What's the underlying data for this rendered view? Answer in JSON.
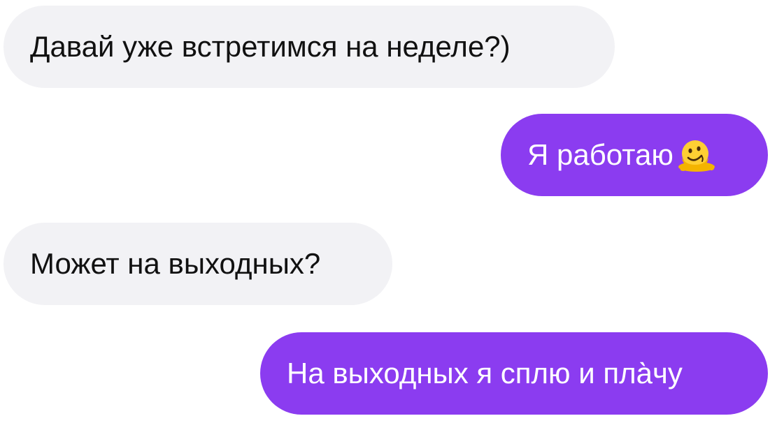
{
  "messages": [
    {
      "direction": "incoming",
      "text": "Давай уже встретимся на неделе?)"
    },
    {
      "direction": "outgoing",
      "text": "Я работаю",
      "emoji": "melting-face-icon"
    },
    {
      "direction": "incoming",
      "text": "Может на выходных?"
    },
    {
      "direction": "outgoing",
      "text": "На выходных я сплю и пла̀чу"
    }
  ],
  "colors": {
    "incoming_bubble": "#f2f2f5",
    "outgoing_bubble": "#8b3cf0",
    "incoming_text": "#111111",
    "outgoing_text": "#ffffff"
  }
}
